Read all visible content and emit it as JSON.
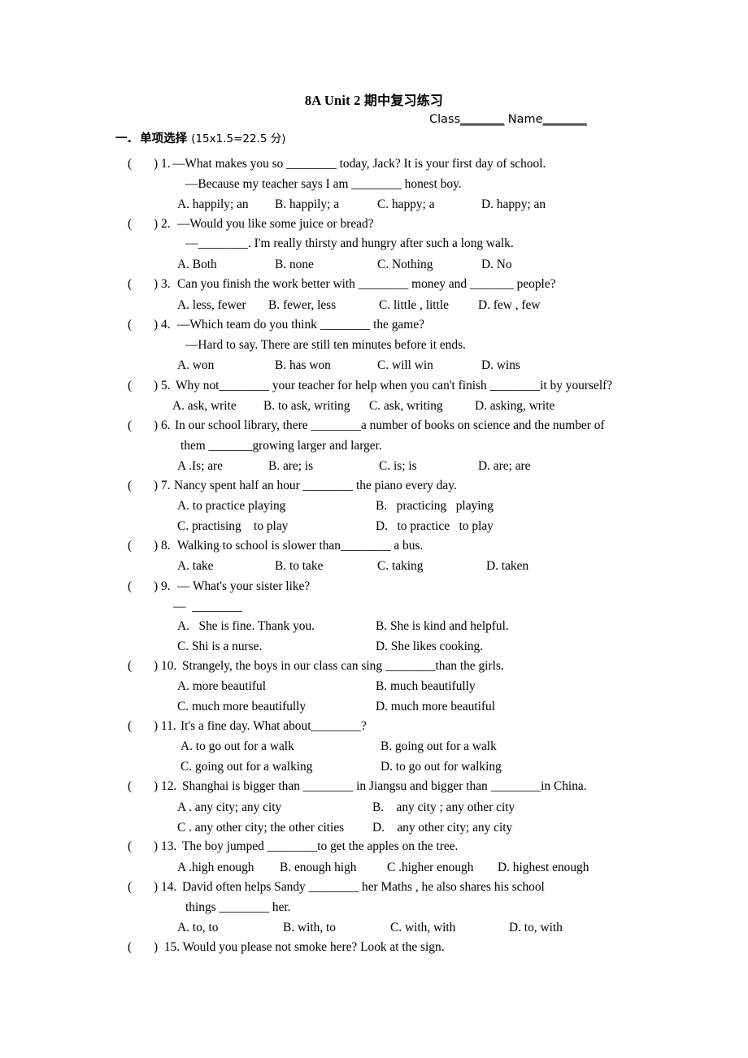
{
  "document": {
    "title_en": "8A Unit 2",
    "title_cn": "期中复习练习",
    "class_label": "Class",
    "class_blank": "________",
    "name_label": "Name",
    "name_blank": "________",
    "section_number": "一.",
    "section_title": "单项选择",
    "section_score": "(15x1.5=22.5 分)",
    "paren_open": "(",
    "paren_close": ")"
  },
  "questions": [
    {
      "number": "1.",
      "stem": "—What makes you so ________ today, Jack? It is your first day of school.",
      "stem_line2": "—Because my teacher says I am ________ honest boy.",
      "options": [
        "A. happily; an",
        "B. happily; a",
        "C. happy; a",
        "D. happy; an"
      ],
      "layout": "four-col"
    },
    {
      "number": "2.",
      "stem": "—Would you like some juice or bread?",
      "stem_line2": "—________. I'm really thirsty and hungry after such a long walk.",
      "options": [
        "A. Both",
        "B. none",
        "C. Nothing",
        "D. No"
      ],
      "layout": "four-col"
    },
    {
      "number": "3.",
      "stem": "Can you finish the work better with ________ money and _______ people?",
      "options": [
        "A. less, fewer",
        "B. fewer, less",
        "C. little , little",
        "D. few , few"
      ],
      "layout": "four-col"
    },
    {
      "number": "4.",
      "stem": "—Which team do you think ________ the game?",
      "stem_line2": "—Hard to say. There are still ten minutes before it ends.",
      "options": [
        "A. won",
        "B. has won",
        "C. will win",
        "D. wins"
      ],
      "layout": "four-col"
    },
    {
      "number": "5.",
      "stem": "Why not________ your teacher for help when you can't finish ________it by yourself?",
      "options": [
        "A. ask, write",
        "B. to ask, writing",
        "C. ask, writing",
        "D. asking, write"
      ],
      "layout": "four-col-narrow"
    },
    {
      "number": "6.",
      "stem": "In our school library, there ________a number of books on science and the number of",
      "stem_line2": "them _______growing larger and larger.",
      "options": [
        "A .Is; are",
        "B. are; is",
        "C. is; is",
        "D. are; are"
      ],
      "layout": "four-col"
    },
    {
      "number": "7.",
      "stem": "Nancy spent half an hour ________ the piano every day.",
      "options": [
        "A. to practice playing",
        "B.   practicing   playing",
        "C. practising    to play",
        "D.   to practice   to play"
      ],
      "layout": "two-col"
    },
    {
      "number": "8.",
      "stem": "Walking to school is slower than________ a bus.",
      "options": [
        "A. take",
        "B. to take",
        "C. taking",
        "D. taken"
      ],
      "layout": "four-col"
    },
    {
      "number": "9.",
      "stem": "— What's your sister like?",
      "stem_line2": "—  ________",
      "options": [
        "A.   She is fine. Thank you.",
        "B. She is kind and helpful.",
        "C. Shi is a nurse.",
        "D. She likes cooking."
      ],
      "layout": "two-col"
    },
    {
      "number": "10.",
      "stem": "Strangely, the boys in our class can sing ________than the girls.",
      "options": [
        "A. more beautiful",
        "B. much beautifully",
        "C. much more beautifully",
        "D. much more beautiful"
      ],
      "layout": "two-col"
    },
    {
      "number": "11.",
      "stem": "It's a fine day. What about________?",
      "options": [
        "A. to go out for a walk",
        "B. going out for a walk",
        "C. going out for a walking",
        "D. to go out for walking"
      ],
      "layout": "two-col"
    },
    {
      "number": "12.",
      "stem": "Shanghai is bigger than ________ in Jiangsu and bigger than ________in China.",
      "options": [
        "A . any city; any city",
        "B.    any city ; any other city",
        "C . any other city; the other cities",
        "D.    any other city; any city"
      ],
      "layout": "two-col"
    },
    {
      "number": "13.",
      "stem": "The boy jumped ________to get the apples on the tree.",
      "options": [
        "A .high enough",
        "B. enough high",
        "C .higher enough",
        "D. highest enough"
      ],
      "layout": "four-col-narrow"
    },
    {
      "number": "14.",
      "stem": "David often helps Sandy ________ her Maths , he also shares his school",
      "stem_line2": "things ________ her.",
      "options": [
        "A. to, to",
        "B. with, to",
        "C. with, with",
        "D. to, with"
      ],
      "layout": "four-col"
    },
    {
      "number": "15.",
      "stem": " 15. Would you please not smoke here? Look at the sign.",
      "options": [],
      "layout": "none"
    }
  ]
}
